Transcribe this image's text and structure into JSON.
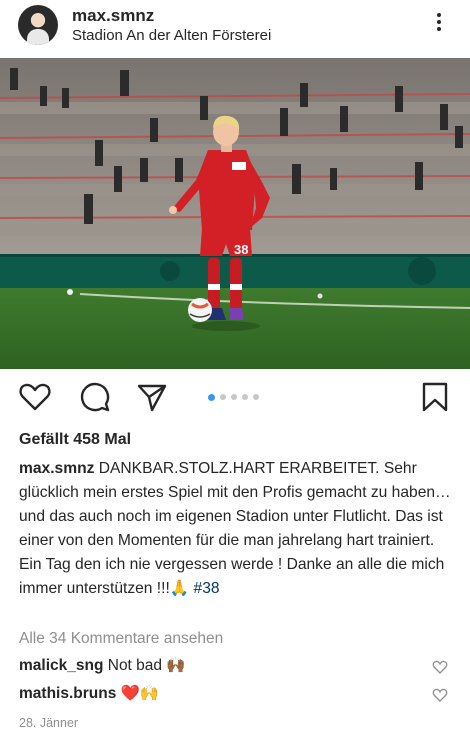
{
  "post": {
    "username": "max.smnz",
    "location": "Stadion An der Alten Försterei",
    "likes_text": "Gefällt 458 Mal",
    "caption_user": "max.smnz",
    "caption_text": " DANKBAR.STOLZ.HART ERARBEITET. Sehr glücklich mein erstes Spiel mit den Profis gemacht zu haben… und das auch noch im eigenen Stadion unter Flutlicht. Das ist einer von den Momenten für die man jahrelang hart trainiert. Ein Tag den ich nie vergessen werde ! Danke an alle die mich immer unterstützen !!!🙏 ",
    "caption_hashtag": "#38",
    "view_comments": "Alle 34 Kommentare ansehen",
    "comments": [
      {
        "user": "malick_sng",
        "text": " Not bad 🙌🏾"
      },
      {
        "user": "mathis.bruns",
        "text": " ❤️🙌"
      }
    ],
    "date": "28. Jänner",
    "carousel": {
      "count": 5,
      "active_index": 0
    },
    "jersey_number": "38"
  },
  "icons": {
    "more": "more-vertical-icon",
    "like": "heart-outline-icon",
    "comment": "comment-bubble-icon",
    "share": "paper-plane-icon",
    "save": "bookmark-icon",
    "comment_like": "small-heart-icon"
  },
  "colors": {
    "text": "#262626",
    "muted": "#8e8e8e",
    "link": "#00376b",
    "carousel_active": "#3897f0",
    "carousel_inactive": "#c7c7c7",
    "jersey": "#d32027"
  }
}
